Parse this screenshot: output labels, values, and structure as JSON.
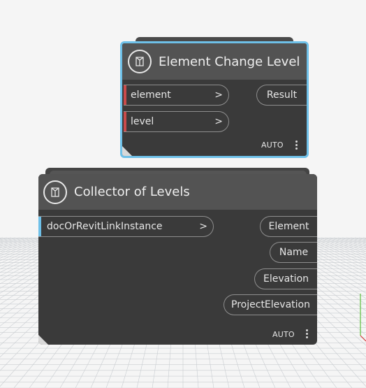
{
  "background": {
    "color": "#f5f5f5",
    "grid_color": "#c9cdd1"
  },
  "nodes": {
    "element_change_level": {
      "title": "Element Change Level",
      "selected": true,
      "highlight_color": "#6ec0e8",
      "inputs": [
        {
          "label": "element",
          "arrow": ">",
          "color": "#c94b4b"
        },
        {
          "label": "level",
          "arrow": ">",
          "color": "#c94b4b"
        }
      ],
      "outputs": [
        {
          "label": "Result"
        }
      ],
      "lacing": "AUTO",
      "icon": "node-logo-icon"
    },
    "collector_of_levels": {
      "title": "Collector of Levels",
      "selected": false,
      "inputs": [
        {
          "label": "docOrRevitLinkInstance",
          "arrow": ">",
          "color": "#6ec0e8"
        }
      ],
      "outputs": [
        {
          "label": "Element"
        },
        {
          "label": "Name"
        },
        {
          "label": "Elevation"
        },
        {
          "label": "ProjectElevation"
        }
      ],
      "lacing": "AUTO",
      "icon": "node-logo-icon"
    }
  }
}
